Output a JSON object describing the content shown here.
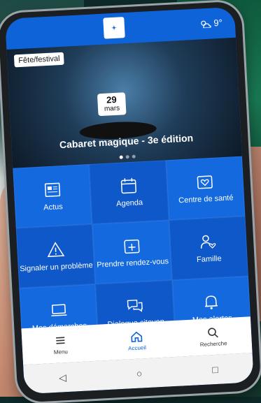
{
  "header": {
    "temperature": "9°",
    "weather_icon": "partly-cloudy-icon"
  },
  "hero": {
    "tag": "Fête/festival",
    "date_day": "29",
    "date_month": "mars",
    "title": "Cabaret magique - 3e édition"
  },
  "tiles": [
    {
      "label": "Actus",
      "icon": "newspaper-icon"
    },
    {
      "label": "Agenda",
      "icon": "calendar-icon"
    },
    {
      "label": "Centre de santé",
      "icon": "health-center-icon"
    },
    {
      "label": "Signaler un problème",
      "icon": "warning-icon"
    },
    {
      "label": "Prendre rendez-vous",
      "icon": "appointment-icon"
    },
    {
      "label": "Famille",
      "icon": "family-icon"
    },
    {
      "label": "Mes démarches",
      "icon": "laptop-icon"
    },
    {
      "label": "Dialogue citoyen",
      "icon": "chat-icon"
    },
    {
      "label": "Mes alertes",
      "icon": "bell-icon"
    }
  ],
  "tabs": [
    {
      "label": "Menu",
      "icon": "menu-icon"
    },
    {
      "label": "Accueil",
      "icon": "home-icon"
    },
    {
      "label": "Recherche",
      "icon": "search-icon"
    }
  ],
  "system_nav": {
    "back": "◁",
    "home": "○",
    "recents": "□"
  },
  "colors": {
    "primary": "#0e63d9",
    "tile_light": "#1469df",
    "tile_dark": "#0e58c9"
  }
}
